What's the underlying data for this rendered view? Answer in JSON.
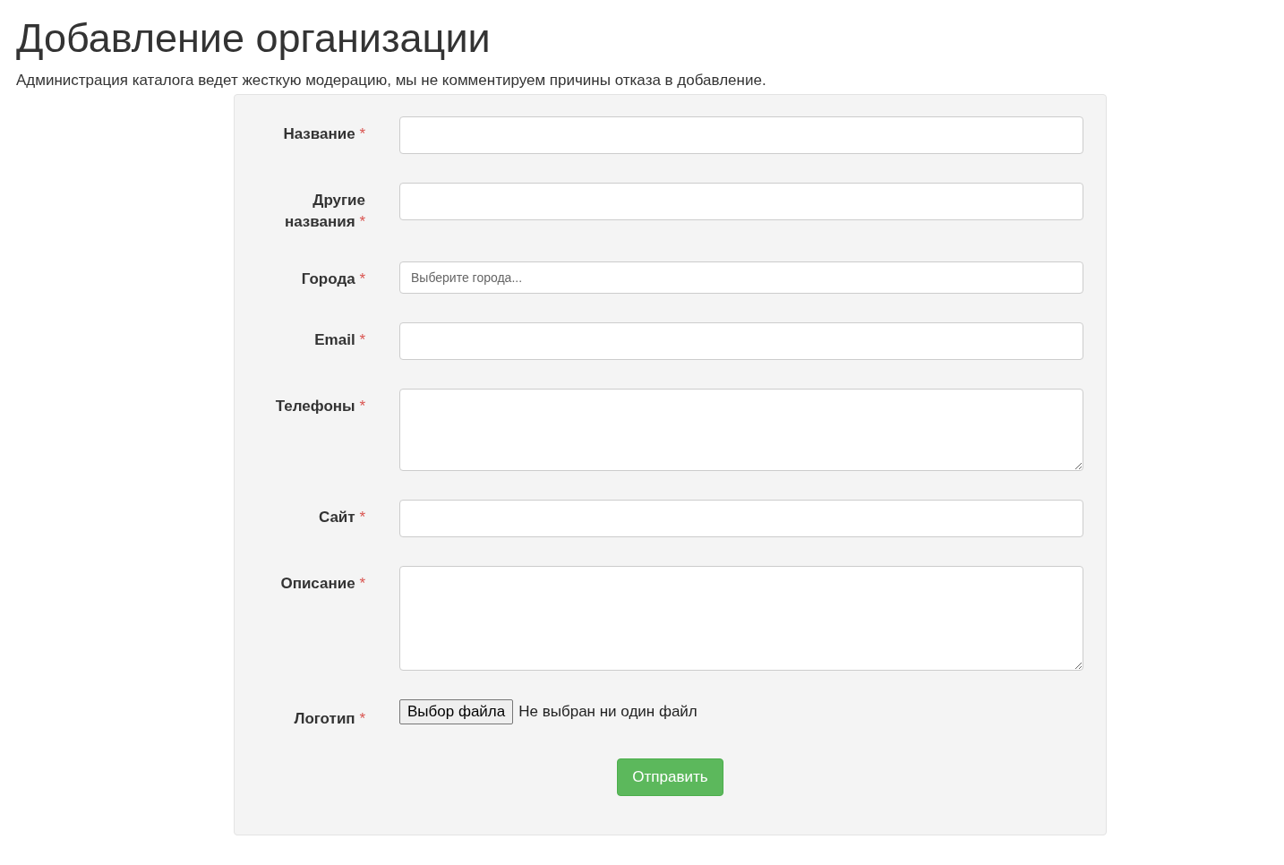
{
  "title": "Добавление организации",
  "subtitle": "Администрация каталога ведет жесткую модерацию, мы не комментируем причины отказа в добавление.",
  "fields": [
    {
      "kind": "text",
      "label": "Название",
      "required_mark": "*"
    },
    {
      "kind": "text",
      "label": "Другие названия",
      "required_mark": "*"
    },
    {
      "kind": "select",
      "label": "Города",
      "required_mark": "*",
      "placeholder": "Выберите города..."
    },
    {
      "kind": "text",
      "label": "Email",
      "required_mark": "*"
    },
    {
      "kind": "textarea",
      "label": "Телефоны",
      "required_mark": "*"
    },
    {
      "kind": "text",
      "label": "Сайт",
      "required_mark": "*"
    },
    {
      "kind": "tallarea",
      "label": "Описание",
      "required_mark": "*"
    },
    {
      "kind": "file",
      "label": "Логотип",
      "required_mark": "*",
      "button": "Выбор файла",
      "status": "Не выбран ни один файл"
    }
  ],
  "submit": "Отправить"
}
